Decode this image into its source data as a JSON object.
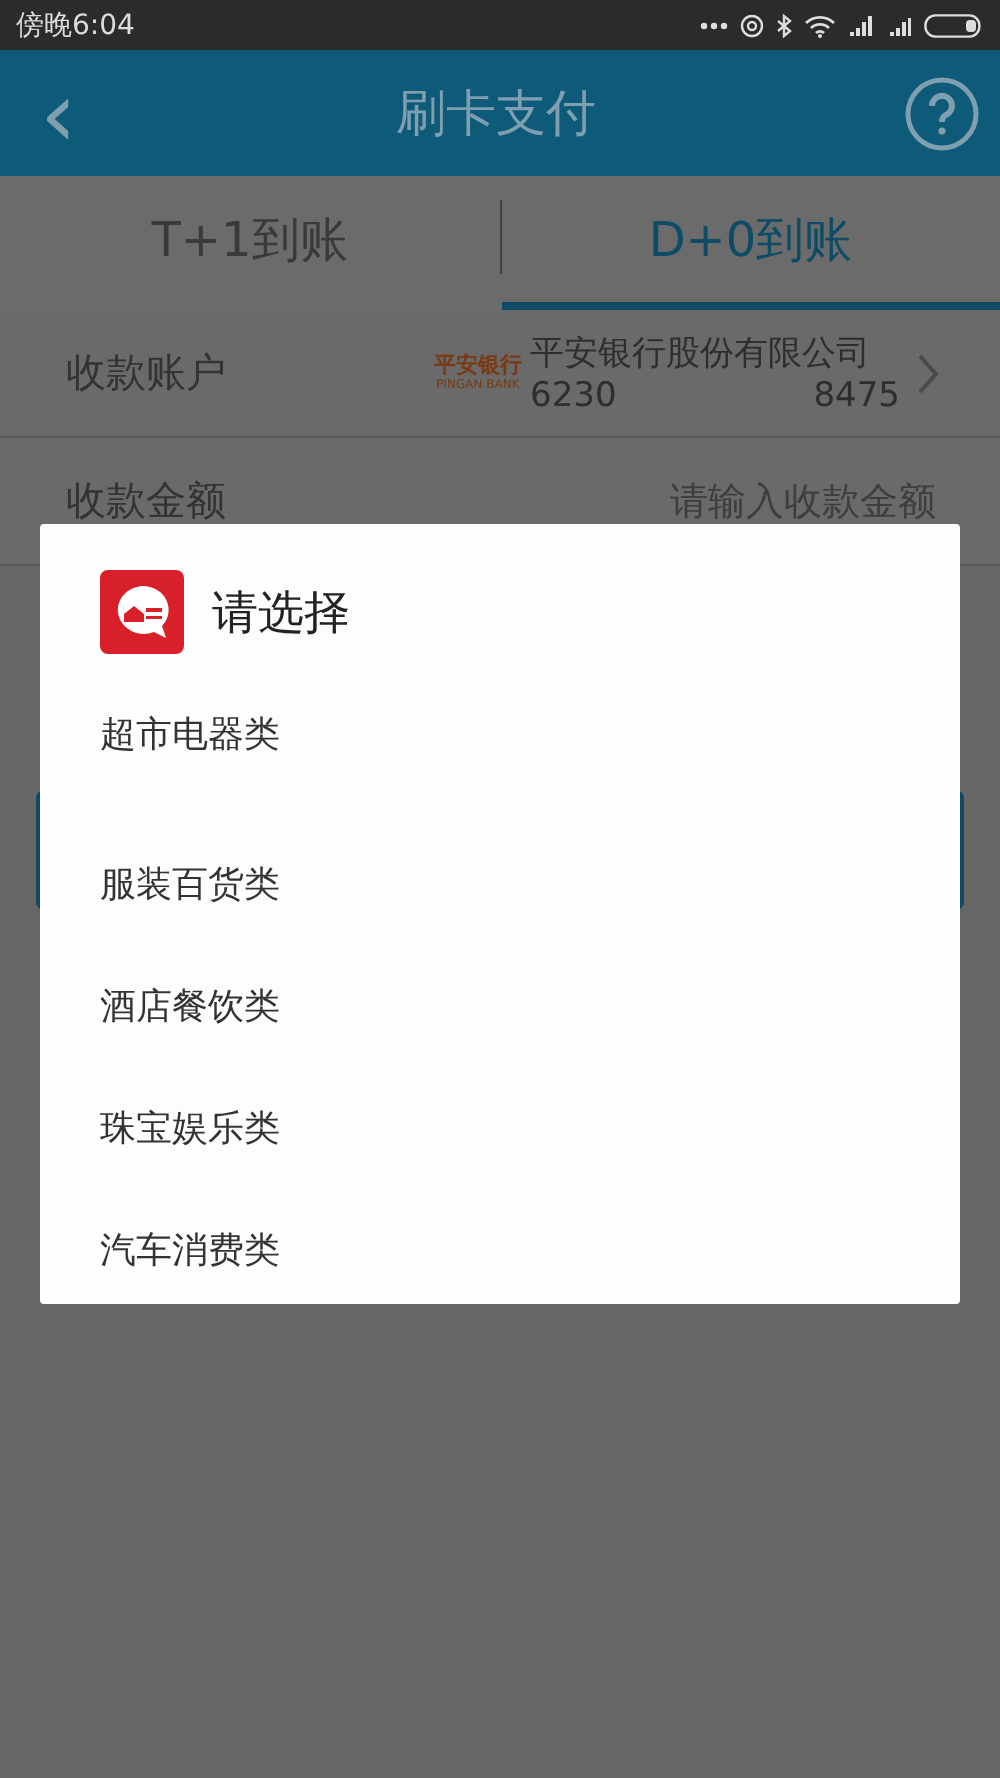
{
  "status_bar": {
    "time": "傍晚6:04"
  },
  "header": {
    "back": "‹",
    "title": "刷卡支付"
  },
  "tabs": [
    {
      "label": "T+1到账",
      "selected": false
    },
    {
      "label": "D+0到账",
      "selected": true
    }
  ],
  "account_row": {
    "label": "收款账户",
    "bank_logo": {
      "name": "平安银行",
      "latin": "PINGAN BANK"
    },
    "bank_name": "平安银行股份有限公司",
    "card_start": "6230",
    "card_end": "8475"
  },
  "amount_row": {
    "label": "收款金额",
    "placeholder": "请输入收款金额"
  },
  "dialog": {
    "title": "请选择",
    "options": [
      {
        "label": "超市电器类"
      },
      {
        "label": "服装百货类"
      },
      {
        "label": "酒店餐饮类"
      },
      {
        "label": "珠宝娱乐类"
      },
      {
        "label": "汽车消费类"
      }
    ]
  }
}
